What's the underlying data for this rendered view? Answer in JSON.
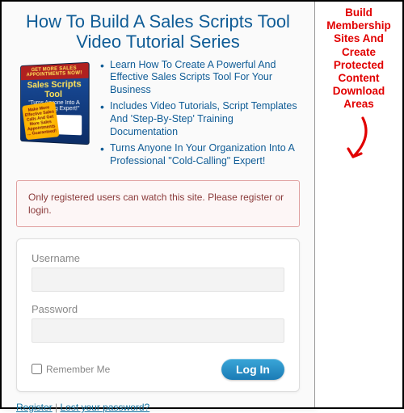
{
  "headline": "How To Build A Sales Scripts Tool Video Tutorial Series",
  "product_box": {
    "banner": "GET MORE SALES APPOINTMENTS NOW!",
    "title": "Sales Scripts Tool",
    "subtitle": "\"Turns Anyone Into A Cold-Calling Expert!\"",
    "burst": "Make More Effective Sales Calls And Get More Sales Appointments ... Guaranteed!"
  },
  "bullets": [
    "Learn How To Create A Powerful And Effective Sales Scripts Tool For Your Business",
    "Includes Video Tutorials, Script Templates And 'Step-By-Step' Training Documentation",
    "Turns Anyone In Your Organization Into A Professional \"Cold-Calling\" Expert!"
  ],
  "warning": "Only registered users can watch this site. Please register or login.",
  "login": {
    "username_label": "Username",
    "password_label": "Password",
    "remember_label": "Remember Me",
    "submit_label": "Log In"
  },
  "links": {
    "register": "Register",
    "separator": " | ",
    "lost": "Lost your password?"
  },
  "callout": "Build Membership Sites And Create Protected Content Download Areas"
}
